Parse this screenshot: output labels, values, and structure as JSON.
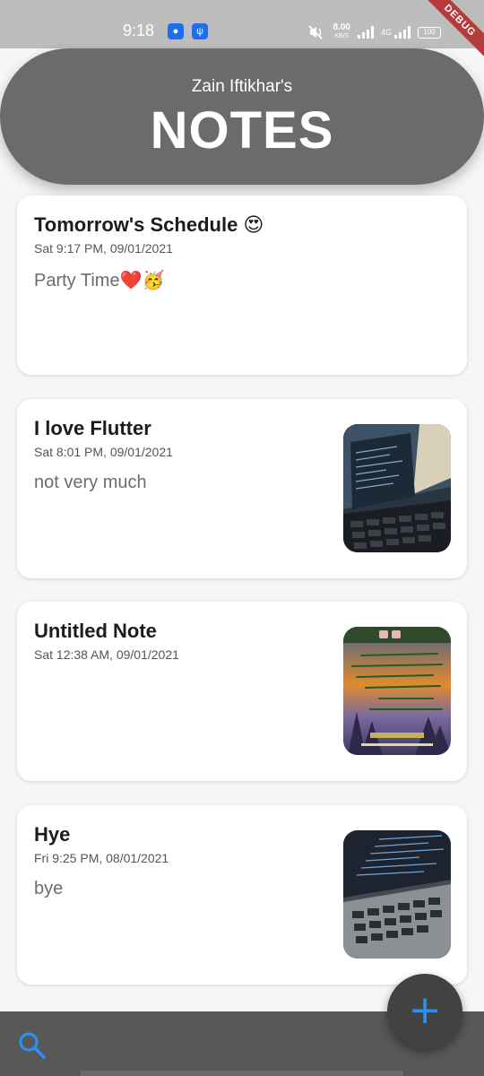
{
  "status_bar": {
    "time": "9:18",
    "net_speed_value": "8.00",
    "net_speed_unit": "KB/S",
    "network_type": "4G",
    "battery": "100"
  },
  "debug_banner": "DEBUG",
  "header": {
    "subtitle": "Zain Iftikhar's",
    "title": "NOTES"
  },
  "notes": [
    {
      "title": "Tomorrow's Schedule 😍",
      "date": "Sat 9:17 PM, 09/01/2021",
      "body": "Party Time❤️🥳",
      "has_image": false
    },
    {
      "title": "I love Flutter",
      "date": "Sat 8:01 PM, 09/01/2021",
      "body": "not very much",
      "has_image": true,
      "image": "laptop-photo"
    },
    {
      "title": "Untitled Note",
      "date": "Sat 12:38 AM, 09/01/2021",
      "body": "",
      "has_image": true,
      "image": "poetry-card-photo"
    },
    {
      "title": "Hye",
      "date": "Fri 9:25 PM, 08/01/2021",
      "body": "bye",
      "has_image": true,
      "image": "laptop-code-photo"
    }
  ],
  "fab": {
    "icon": "plus-icon",
    "label": "+"
  },
  "bottom_bar": {
    "search_icon": "search-icon"
  },
  "colors": {
    "header": "#6b6b6b",
    "accent": "#2d8ff0",
    "bottom_bar": "#585858",
    "debug": "#b53a3a"
  }
}
